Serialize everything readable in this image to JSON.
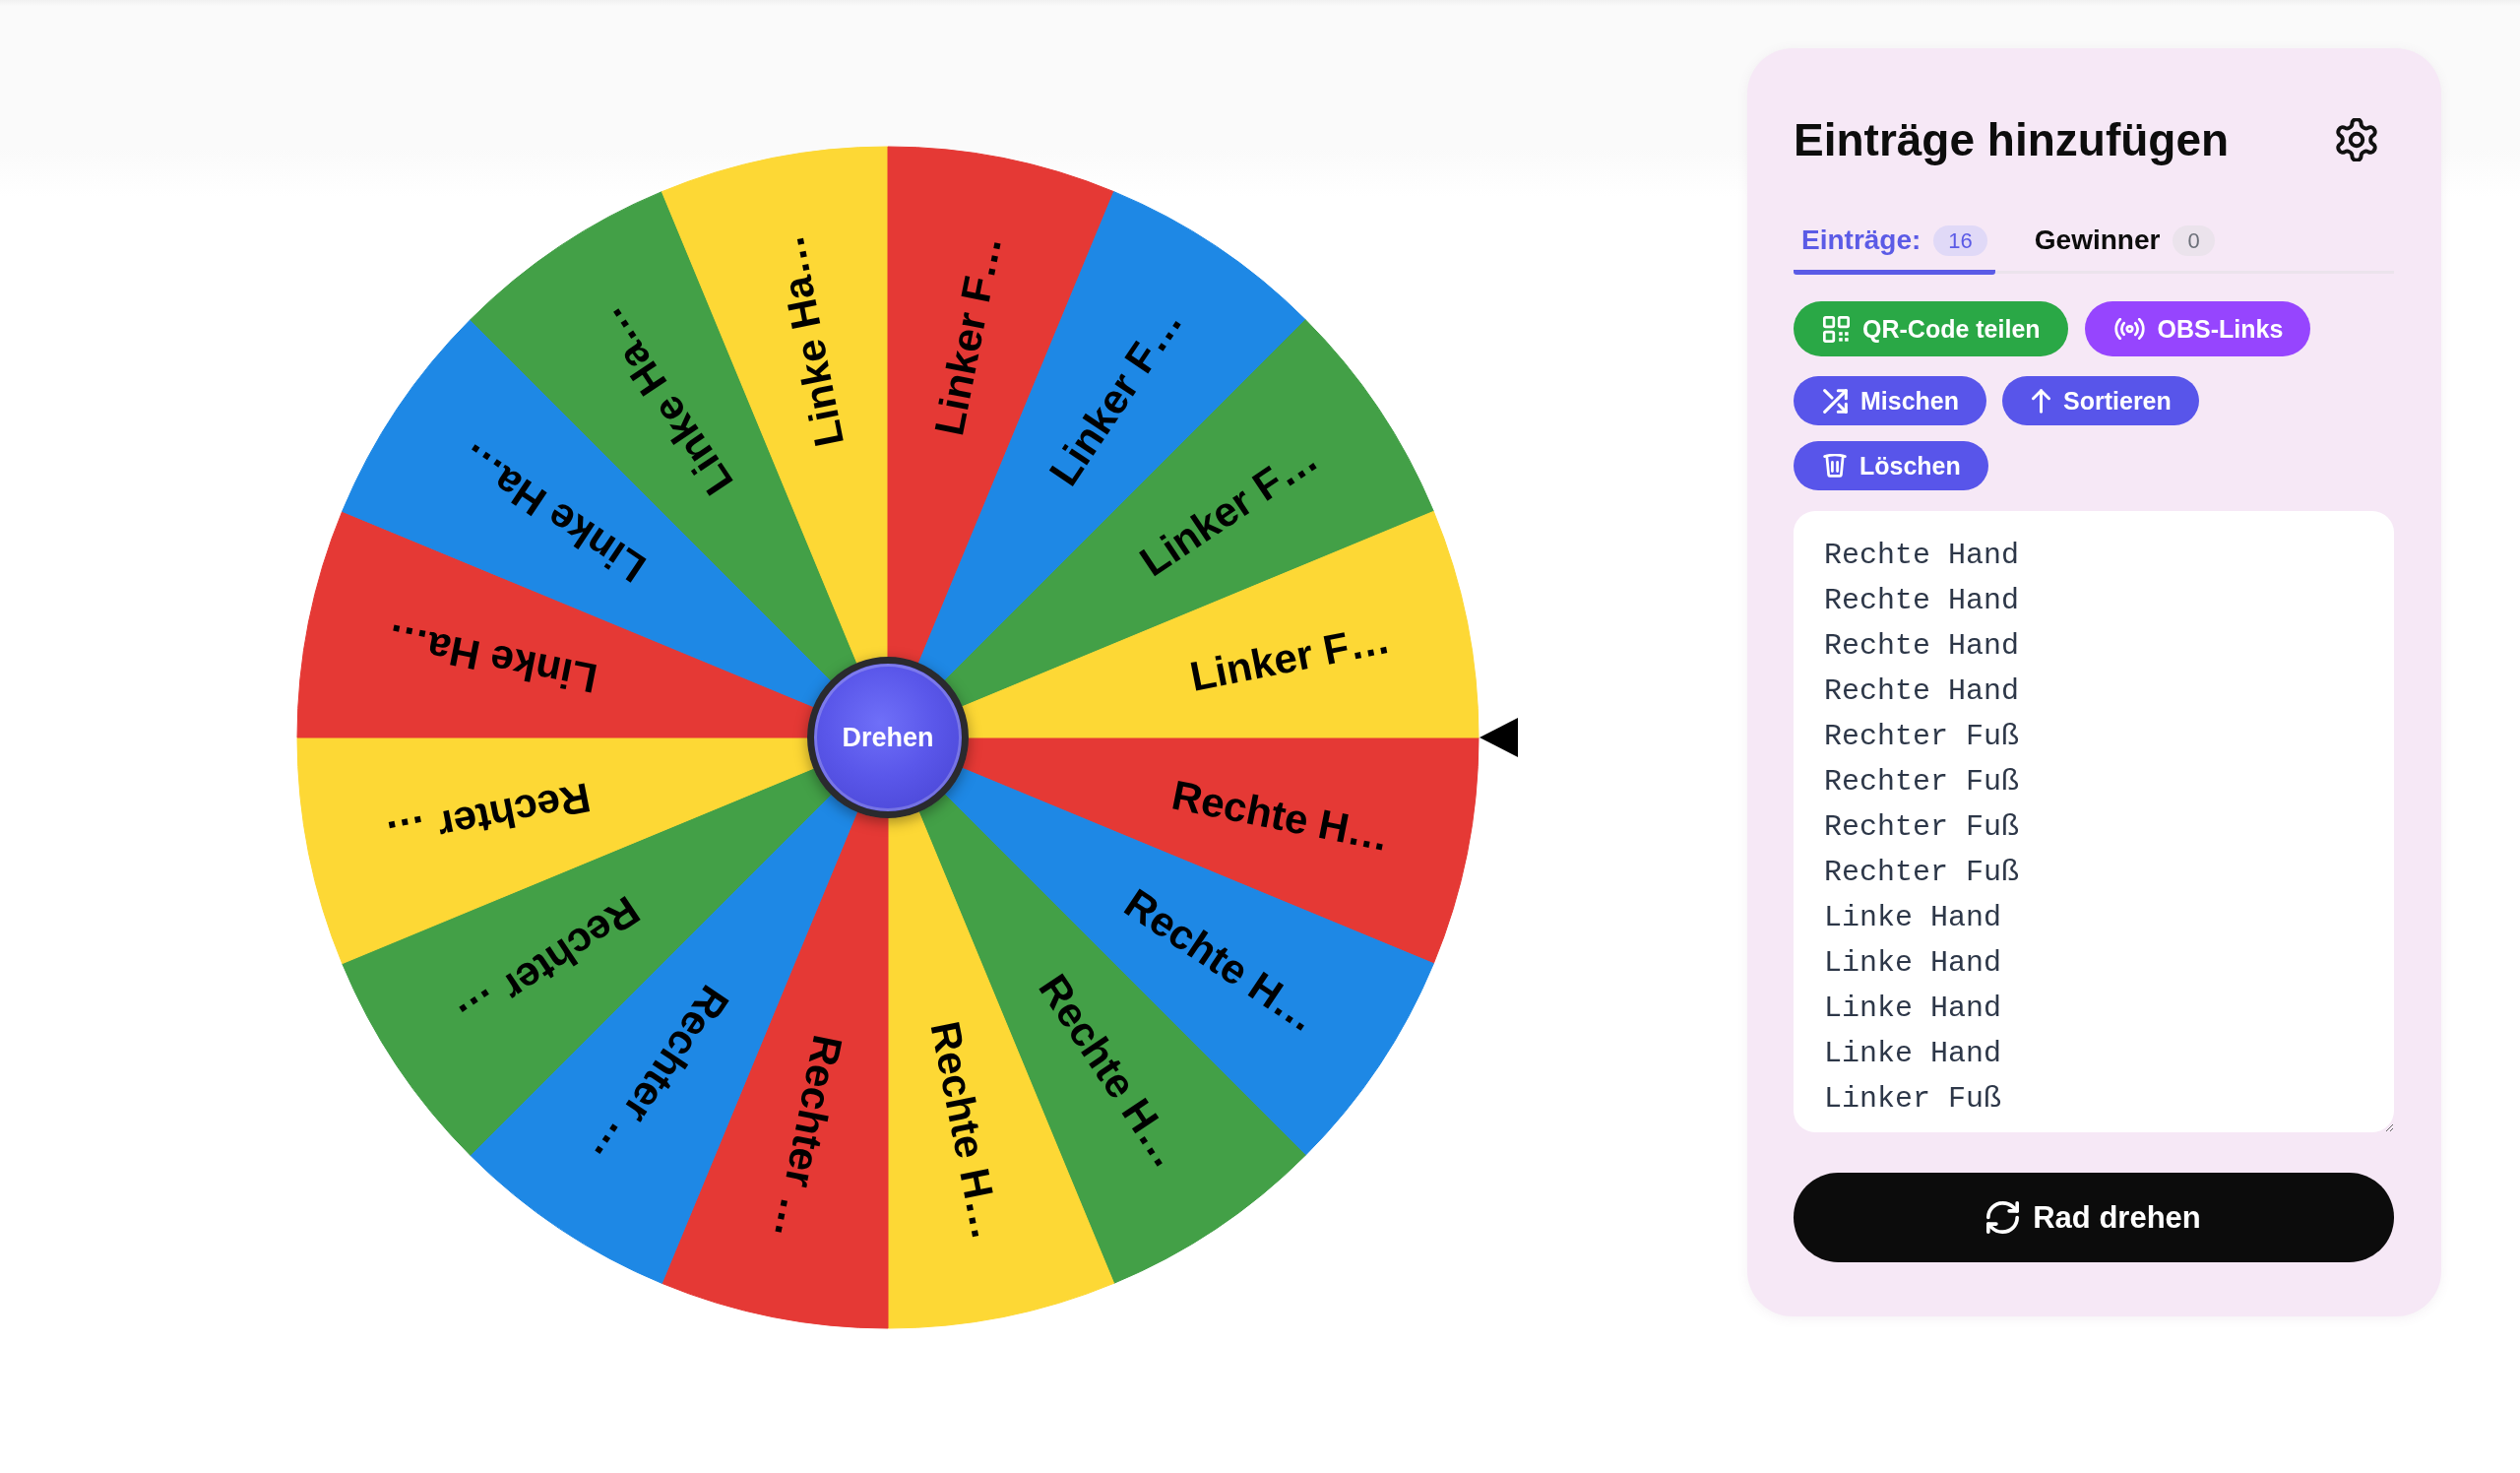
{
  "wheel": {
    "segments": [
      {
        "label": "Rechte H…",
        "color": "#e53935"
      },
      {
        "label": "Rechte H…",
        "color": "#1e88e5"
      },
      {
        "label": "Rechte H…",
        "color": "#43a047"
      },
      {
        "label": "Rechte H…",
        "color": "#fdd835"
      },
      {
        "label": "Rechter …",
        "color": "#e53935"
      },
      {
        "label": "Rechter …",
        "color": "#1e88e5"
      },
      {
        "label": "Rechter …",
        "color": "#43a047"
      },
      {
        "label": "Rechter …",
        "color": "#fdd835"
      },
      {
        "label": "Linke Ha…",
        "color": "#e53935"
      },
      {
        "label": "Linke Ha…",
        "color": "#1e88e5"
      },
      {
        "label": "Linke Ha…",
        "color": "#43a047"
      },
      {
        "label": "Linke Ha…",
        "color": "#fdd835"
      },
      {
        "label": "Linker F…",
        "color": "#e53935"
      },
      {
        "label": "Linker F…",
        "color": "#1e88e5"
      },
      {
        "label": "Linker F…",
        "color": "#43a047"
      },
      {
        "label": "Linker F…",
        "color": "#fdd835"
      }
    ],
    "center_button": "Drehen"
  },
  "panel": {
    "title": "Einträge hinzufügen",
    "tabs": [
      {
        "label": "Einträge:",
        "count": "16",
        "selected": true
      },
      {
        "label": "Gewinner",
        "count": "0",
        "selected": false
      }
    ],
    "share_actions": [
      {
        "label": "QR-Code teilen",
        "kind": "qr"
      },
      {
        "label": "OBS-Links",
        "kind": "broadcast"
      }
    ],
    "list_actions": [
      {
        "label": "Mischen",
        "kind": "shuffle"
      },
      {
        "label": "Sortieren",
        "kind": "sort"
      },
      {
        "label": "Löschen",
        "kind": "delete"
      }
    ],
    "entries": [
      "Rechte Hand",
      "Rechte Hand",
      "Rechte Hand",
      "Rechte Hand",
      "Rechter Fuß",
      "Rechter Fuß",
      "Rechter Fuß",
      "Rechter Fuß",
      "Linke Hand",
      "Linke Hand",
      "Linke Hand",
      "Linke Hand",
      "Linker Fuß"
    ],
    "spin_button": "Rad drehen"
  }
}
